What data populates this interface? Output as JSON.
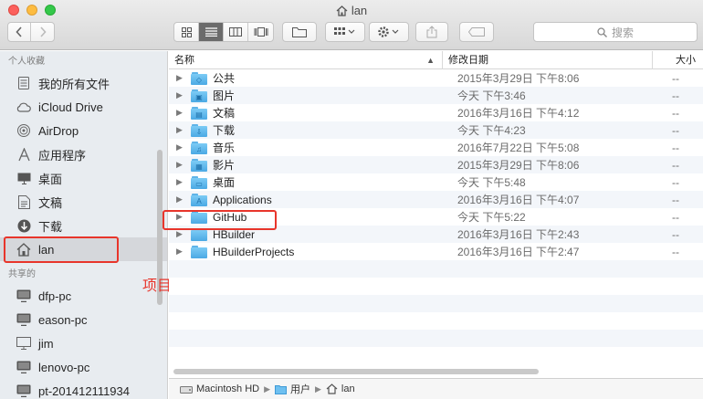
{
  "window": {
    "title": "lan"
  },
  "toolbar": {
    "search_placeholder": "搜索"
  },
  "sidebar": {
    "favorites_header": "个人收藏",
    "favorites": [
      {
        "label": "我的所有文件",
        "icon": "all-files-icon"
      },
      {
        "label": "iCloud Drive",
        "icon": "cloud-icon"
      },
      {
        "label": "AirDrop",
        "icon": "airdrop-icon"
      },
      {
        "label": "应用程序",
        "icon": "applications-icon"
      },
      {
        "label": "桌面",
        "icon": "desktop-icon"
      },
      {
        "label": "文稿",
        "icon": "documents-icon"
      },
      {
        "label": "下载",
        "icon": "downloads-icon"
      },
      {
        "label": "lan",
        "icon": "home-icon"
      }
    ],
    "shared_header": "共享的",
    "shared": [
      {
        "label": "dfp-pc",
        "icon": "computer-icon"
      },
      {
        "label": "eason-pc",
        "icon": "computer-icon"
      },
      {
        "label": "jim",
        "icon": "computer-icon"
      },
      {
        "label": "lenovo-pc",
        "icon": "computer-icon"
      },
      {
        "label": "pt-201412111934",
        "icon": "computer-icon"
      }
    ]
  },
  "annotation": {
    "label": "项目路径",
    "color": "#e8352b"
  },
  "list": {
    "columns": {
      "name": "名称",
      "date": "修改日期",
      "size": "大小"
    },
    "rows": [
      {
        "name": "公共",
        "date": "2015年3月29日 下午8:06",
        "size": "--",
        "glyph": "◇"
      },
      {
        "name": "图片",
        "date": "今天 下午3:46",
        "size": "--",
        "glyph": "▣"
      },
      {
        "name": "文稿",
        "date": "2016年3月16日 下午4:12",
        "size": "--",
        "glyph": "▤"
      },
      {
        "name": "下载",
        "date": "今天 下午4:23",
        "size": "--",
        "glyph": "⇩"
      },
      {
        "name": "音乐",
        "date": "2016年7月22日 下午5:08",
        "size": "--",
        "glyph": "♫"
      },
      {
        "name": "影片",
        "date": "2015年3月29日 下午8:06",
        "size": "--",
        "glyph": "▦"
      },
      {
        "name": "桌面",
        "date": "今天 下午5:48",
        "size": "--",
        "glyph": "▭"
      },
      {
        "name": "Applications",
        "date": "2016年3月16日 下午4:07",
        "size": "--",
        "glyph": "A"
      },
      {
        "name": "GitHub",
        "date": "今天 下午5:22",
        "size": "--",
        "glyph": ""
      },
      {
        "name": "HBuilder",
        "date": "2016年3月16日 下午2:43",
        "size": "--",
        "glyph": ""
      },
      {
        "name": "HBuilderProjects",
        "date": "2016年3月16日 下午2:47",
        "size": "--",
        "glyph": ""
      }
    ]
  },
  "pathbar": {
    "items": [
      "Macintosh HD",
      "用户",
      "lan"
    ]
  }
}
